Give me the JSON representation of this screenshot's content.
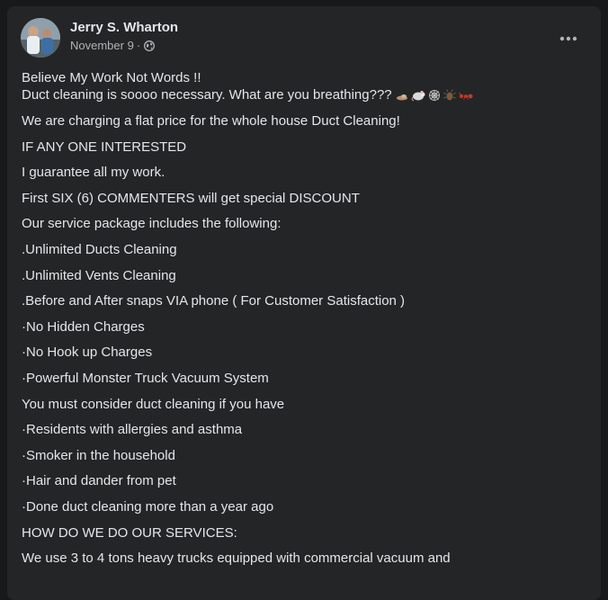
{
  "post": {
    "author": "Jerry S. Wharton",
    "date": "November 9",
    "separator": "·",
    "privacy_icon": "globe-icon",
    "more_icon": "more-options-icon",
    "first_lines": [
      "Believe My Work Not Words !!",
      "Duct cleaning is soooo necessary. What are you breathing???"
    ],
    "emojis": [
      "dust-emoji",
      "rat-emoji",
      "spider-web-emoji",
      "bug-emoji",
      "ant-emoji"
    ],
    "lines": [
      "We are charging a flat price for the whole house Duct Cleaning!",
      "IF ANY ONE INTERESTED",
      "I guarantee all my work.",
      "First SIX (6) COMMENTERS will get special DISCOUNT",
      "Our service package includes the following:",
      ".Unlimited Ducts Cleaning",
      ".Unlimited Vents Cleaning",
      ".Before and After snaps VIA phone ( For Customer Satisfaction )",
      "·No Hidden Charges",
      "·No Hook up Charges",
      "·Powerful Monster Truck Vacuum System",
      "You must consider duct cleaning if you have",
      "·Residents with allergies and asthma",
      "·Smoker in the household",
      "·Hair and dander from pet",
      "·Done duct cleaning more than a year ago",
      "HOW DO WE DO OUR SERVICES:",
      "We use 3 to 4 tons heavy trucks equipped with commercial vacuum and"
    ]
  }
}
